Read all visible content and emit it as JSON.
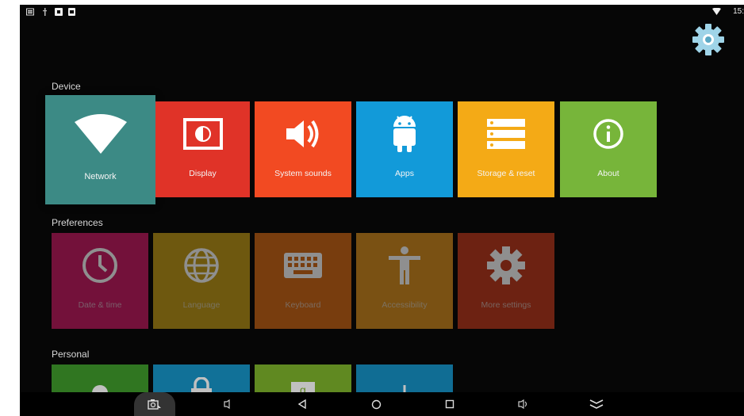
{
  "status_bar": {
    "time": "15:"
  },
  "colors": {
    "network": "#3c8a85",
    "display": "#e03328",
    "system_sounds": "#f24a22",
    "apps": "#129ad9",
    "storage": "#f4aa16",
    "about": "#77b53a",
    "date_time": "#cd1a66",
    "language": "#c49c17",
    "keyboard": "#d66a16",
    "accessibility": "#d98f1e",
    "more_settings": "#c23a1c",
    "personal_1": "#3f9c2a",
    "personal_2": "#1595c9",
    "personal_3": "#7fb52a",
    "personal_4": "#1490c4"
  },
  "sections": {
    "device": "Device",
    "preferences": "Preferences",
    "personal": "Personal"
  },
  "device_tiles": {
    "network": "Network",
    "display": "Display",
    "system_sounds": "System sounds",
    "apps": "Apps",
    "storage": "Storage & reset",
    "about": "About"
  },
  "preference_tiles": {
    "date_time": "Date & time",
    "language": "Language",
    "keyboard": "Keyboard",
    "accessibility": "Accessibility",
    "more_settings": "More settings"
  },
  "icons": {
    "settings": "gear-icon",
    "network": "wifi-icon",
    "display": "brightness-icon",
    "sounds": "speaker-icon",
    "apps": "android-icon",
    "storage": "storage-icon",
    "about": "info-icon",
    "date_time": "clock-icon",
    "language": "globe-icon",
    "keyboard": "keyboard-icon",
    "accessibility": "accessibility-icon",
    "more_settings": "gear-icon"
  }
}
